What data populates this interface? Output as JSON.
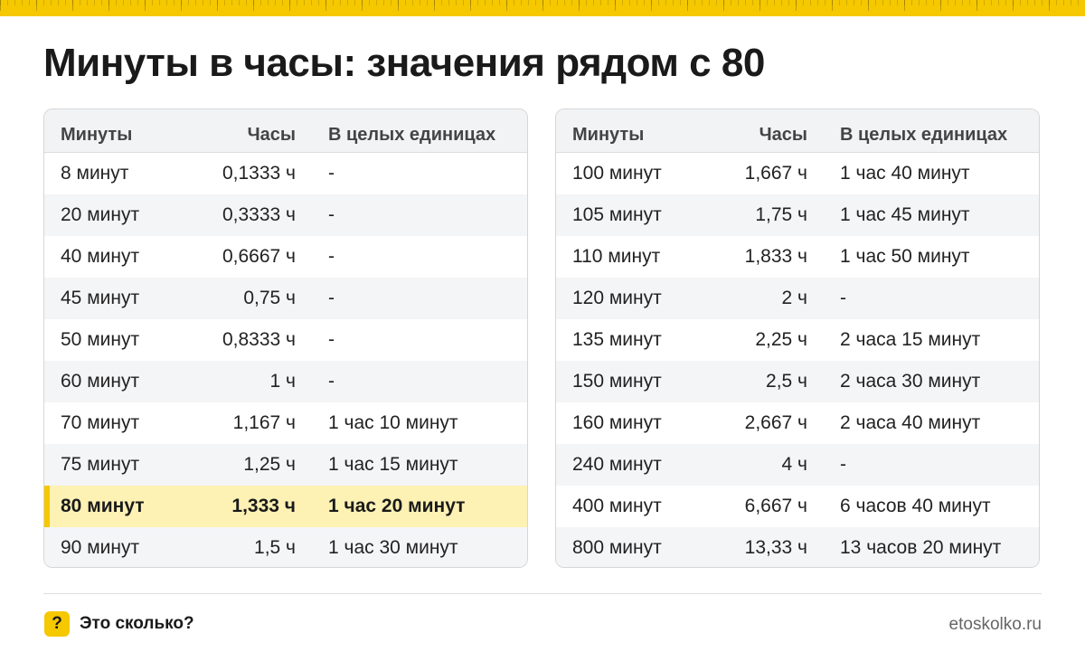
{
  "title": "Минуты в часы: значения рядом с 80",
  "colors": {
    "accent": "#f5c800",
    "highlight_row": "#fdf1b4",
    "header_bg": "#f2f3f5",
    "alt_row": "#f4f5f7"
  },
  "columns": [
    "Минуты",
    "Часы",
    "В целых единицах"
  ],
  "left_table": [
    {
      "minutes": "8 минут",
      "hours": "0,1333 ч",
      "whole": "-"
    },
    {
      "minutes": "20 минут",
      "hours": "0,3333 ч",
      "whole": "-"
    },
    {
      "minutes": "40 минут",
      "hours": "0,6667 ч",
      "whole": "-"
    },
    {
      "minutes": "45 минут",
      "hours": "0,75 ч",
      "whole": "-"
    },
    {
      "minutes": "50 минут",
      "hours": "0,8333 ч",
      "whole": "-"
    },
    {
      "minutes": "60 минут",
      "hours": "1 ч",
      "whole": "-"
    },
    {
      "minutes": "70 минут",
      "hours": "1,167 ч",
      "whole": "1 час 10 минут"
    },
    {
      "minutes": "75 минут",
      "hours": "1,25 ч",
      "whole": "1 час 15 минут"
    },
    {
      "minutes": "80 минут",
      "hours": "1,333 ч",
      "whole": "1 час 20 минут",
      "highlighted": true
    },
    {
      "minutes": "90 минут",
      "hours": "1,5 ч",
      "whole": "1 час 30 минут"
    }
  ],
  "right_table": [
    {
      "minutes": "100 минут",
      "hours": "1,667 ч",
      "whole": "1 час 40 минут"
    },
    {
      "minutes": "105 минут",
      "hours": "1,75 ч",
      "whole": "1 час 45 минут"
    },
    {
      "minutes": "110 минут",
      "hours": "1,833 ч",
      "whole": "1 час 50 минут"
    },
    {
      "minutes": "120 минут",
      "hours": "2 ч",
      "whole": "-"
    },
    {
      "minutes": "135 минут",
      "hours": "2,25 ч",
      "whole": "2 часа 15 минут"
    },
    {
      "minutes": "150 минут",
      "hours": "2,5 ч",
      "whole": "2 часа 30 минут"
    },
    {
      "minutes": "160 минут",
      "hours": "2,667 ч",
      "whole": "2 часа 40 минут"
    },
    {
      "minutes": "240 минут",
      "hours": "4 ч",
      "whole": "-"
    },
    {
      "minutes": "400 минут",
      "hours": "6,667 ч",
      "whole": "6 часов 40 минут"
    },
    {
      "minutes": "800 минут",
      "hours": "13,33 ч",
      "whole": "13 часов 20 минут"
    }
  ],
  "footer": {
    "badge": "?",
    "brand": "Это сколько?",
    "site": "etoskolko.ru"
  }
}
